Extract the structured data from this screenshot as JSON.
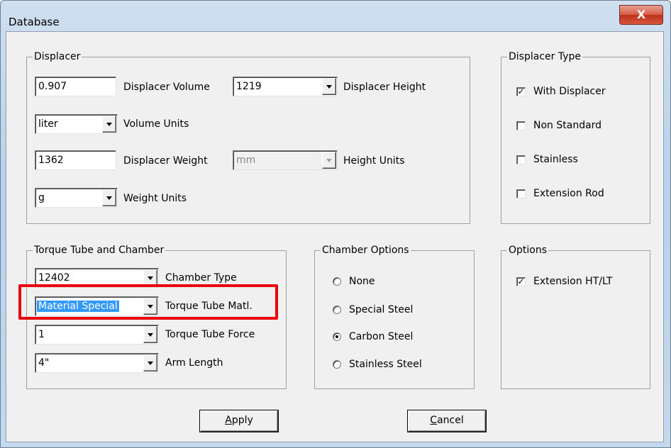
{
  "window": {
    "title": "Database",
    "close_glyph": "X"
  },
  "displacer": {
    "title": "Displacer",
    "volume_value": "0.907",
    "volume_label": "Displacer Volume",
    "height_value": "1219",
    "height_label": "Displacer Height",
    "volume_units_value": "liter",
    "volume_units_label": "Volume Units",
    "weight_value": "1362",
    "weight_label": "Displacer Weight",
    "height_units_value": "mm",
    "height_units_label": "Height Units",
    "weight_units_value": "g",
    "weight_units_label": "Weight Units"
  },
  "displacer_type": {
    "title": "Displacer Type",
    "options": [
      {
        "label": "With Displacer",
        "checked": true,
        "mark": "✓"
      },
      {
        "label": "Non Standard",
        "checked": false,
        "mark": ""
      },
      {
        "label": "Stainless",
        "checked": false,
        "mark": ""
      },
      {
        "label": "Extension Rod",
        "checked": false,
        "mark": ""
      }
    ]
  },
  "torque": {
    "title": "Torque Tube and Chamber",
    "chamber_type_value": "12402",
    "chamber_type_label": "Chamber Type",
    "matl_value": "Material Special",
    "matl_label": "Torque Tube Matl.",
    "force_value": "1",
    "force_label": "Torque Tube Force",
    "arm_value": "4\"",
    "arm_label": "Arm Length"
  },
  "chamber_options": {
    "title": "Chamber Options",
    "options": [
      {
        "label": "None",
        "selected": false
      },
      {
        "label": "Special Steel",
        "selected": false
      },
      {
        "label": "Carbon Steel",
        "selected": true
      },
      {
        "label": "Stainless Steel",
        "selected": false
      }
    ]
  },
  "options": {
    "title": "Options",
    "extension_label": "Extension HT/LT",
    "extension_checked": true,
    "extension_mark": "✓"
  },
  "buttons": {
    "apply_mnemonic": "A",
    "apply_rest": "pply",
    "cancel_mnemonic": "C",
    "cancel_rest": "ancel"
  },
  "colors": {
    "highlight": "#e8000b",
    "selection": "#3399ff"
  }
}
